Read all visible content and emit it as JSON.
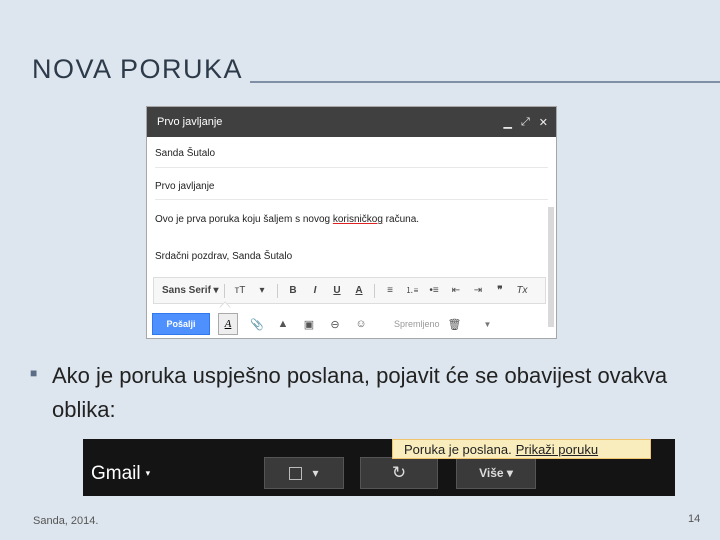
{
  "slide": {
    "title": "NOVA PORUKA",
    "bullet_text": "Ako je poruka uspješno poslana, pojavit će se obavijest ovakva oblika:",
    "footer_left": "Sanda, 2014.",
    "page_number": "14"
  },
  "compose": {
    "window_title": "Prvo javljanje",
    "head_icons": [
      "minimize-icon",
      "popout-icon",
      "close-icon"
    ],
    "to": "Sanda Šutalo",
    "subject": "Prvo javljanje",
    "body_line_pre": "Ovo je prva poruka koju šaljem s novog ",
    "body_line_underlined": "korisničkog",
    "body_line_post": " računa.",
    "signature": "Srdačni pozdrav, Sanda Šutalo",
    "format_toolbar": {
      "font": "Sans Serif",
      "font_caret": "▾",
      "size_icon": "ᴛT",
      "size_caret": "▾",
      "bold": "B",
      "italic": "I",
      "underline": "U",
      "text_color": "A",
      "align": "≡",
      "numbered_list": "⒈≡",
      "bulleted_list": "•≡",
      "indent_less": "⇤",
      "indent_more": "⇥",
      "quote": "❞",
      "clear_format": "Tx"
    },
    "bottom_bar": {
      "send_label": "Pošalji",
      "format_icon_label": "A",
      "attach_icon": "📎",
      "drive_icon": "▲",
      "photo_icon": "▣",
      "link_icon": "⊖",
      "emoji_icon": "☺",
      "saved_label": "Spremljeno",
      "trash_icon": "🗑",
      "more_caret": "▼"
    }
  },
  "gmail_bar": {
    "logo": "Gmail",
    "logo_caret": "▾",
    "checkbox_caret": "▾",
    "refresh_icon": "↻",
    "more_label": "Više",
    "more_caret": "▾",
    "notification_text": "Poruka je poslana.",
    "notification_link": "Prikaži poruku"
  }
}
